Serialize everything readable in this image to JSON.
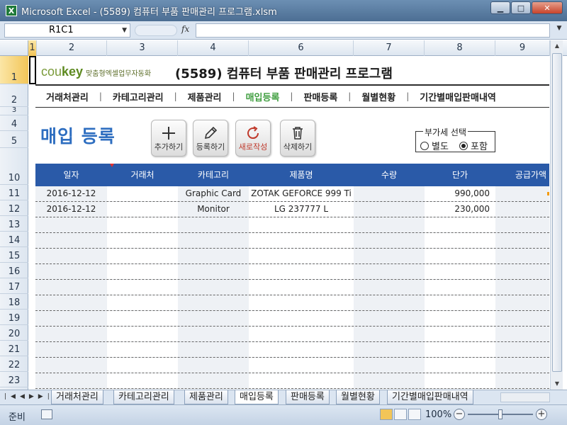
{
  "window": {
    "title": "Microsoft Excel - (5589) 컴퓨터 부품 판매관리 프로그램.xlsm",
    "app_icon": "X",
    "minimize": "▁",
    "maximize": "□",
    "close": "✕"
  },
  "formula_bar": {
    "name_box": "R1C1",
    "fx_label": "fx",
    "formula": ""
  },
  "columns": [
    "1",
    "2",
    "3",
    "4",
    "6",
    "7",
    "8",
    "9"
  ],
  "rows": [
    "1",
    "2",
    "3",
    "4",
    "5",
    "10",
    "11",
    "12",
    "13",
    "14",
    "15",
    "16",
    "17",
    "18",
    "19",
    "20",
    "21",
    "22",
    "23"
  ],
  "brand": {
    "logo_prefix": "cou",
    "logo_suffix": "key",
    "tagline": "맞춤형엑셀업무자동화"
  },
  "program_title": "(5589) 컴퓨터 부품 판매관리 프로그램",
  "menu": [
    {
      "label": "거래처관리",
      "active": false
    },
    {
      "label": "카테고리관리",
      "active": false
    },
    {
      "label": "제품관리",
      "active": false
    },
    {
      "label": "매입등록",
      "active": true
    },
    {
      "label": "판매등록",
      "active": false
    },
    {
      "label": "월별현황",
      "active": false
    },
    {
      "label": "기간별매입판매내역",
      "active": false
    }
  ],
  "menu_separator": "|",
  "page_title": "매입 등록",
  "toolbar": {
    "add": "추가하기",
    "register": "등록하기",
    "new": "새로작성",
    "delete": "삭제하기"
  },
  "vat": {
    "title": "부가세 선택",
    "option_exclusive": "별도",
    "option_inclusive": "포함",
    "selected": "포함"
  },
  "table": {
    "headers": [
      "일자",
      "거래처",
      "카테고리",
      "제품명",
      "수량",
      "단가",
      "공급가액"
    ],
    "rows": [
      [
        "2016-12-12",
        "",
        "Graphic Card",
        "ZOTAK GEFORCE 999 Ti",
        "",
        "990,000",
        ""
      ],
      [
        "2016-12-12",
        "",
        "Monitor",
        "LG 237777 L",
        "",
        "230,000",
        ""
      ],
      [
        "",
        "",
        "",
        "",
        "",
        "",
        ""
      ],
      [
        "",
        "",
        "",
        "",
        "",
        "",
        ""
      ],
      [
        "",
        "",
        "",
        "",
        "",
        "",
        ""
      ],
      [
        "",
        "",
        "",
        "",
        "",
        "",
        ""
      ],
      [
        "",
        "",
        "",
        "",
        "",
        "",
        ""
      ],
      [
        "",
        "",
        "",
        "",
        "",
        "",
        ""
      ],
      [
        "",
        "",
        "",
        "",
        "",
        "",
        ""
      ],
      [
        "",
        "",
        "",
        "",
        "",
        "",
        ""
      ],
      [
        "",
        "",
        "",
        "",
        "",
        "",
        ""
      ],
      [
        "",
        "",
        "",
        "",
        "",
        "",
        ""
      ],
      [
        "",
        "",
        "",
        "",
        "",
        "",
        ""
      ]
    ]
  },
  "sheet_tabs": [
    {
      "label": "거래처관리",
      "active": false
    },
    {
      "label": "카테고리관리",
      "active": false
    },
    {
      "label": "제품관리",
      "active": false
    },
    {
      "label": "매입등록",
      "active": true
    },
    {
      "label": "판매등록",
      "active": false
    },
    {
      "label": "월별현황",
      "active": false
    },
    {
      "label": "기간별매입판매내역",
      "active": false
    }
  ],
  "status": {
    "ready": "준비",
    "zoom": "100%",
    "zoom_minus": "−",
    "zoom_plus": "+"
  },
  "colors": {
    "title_blue": "#2e6ec0",
    "table_header": "#2a5aa8",
    "active_menu": "#3f9e3f",
    "brand_green": "#5d8a20"
  }
}
